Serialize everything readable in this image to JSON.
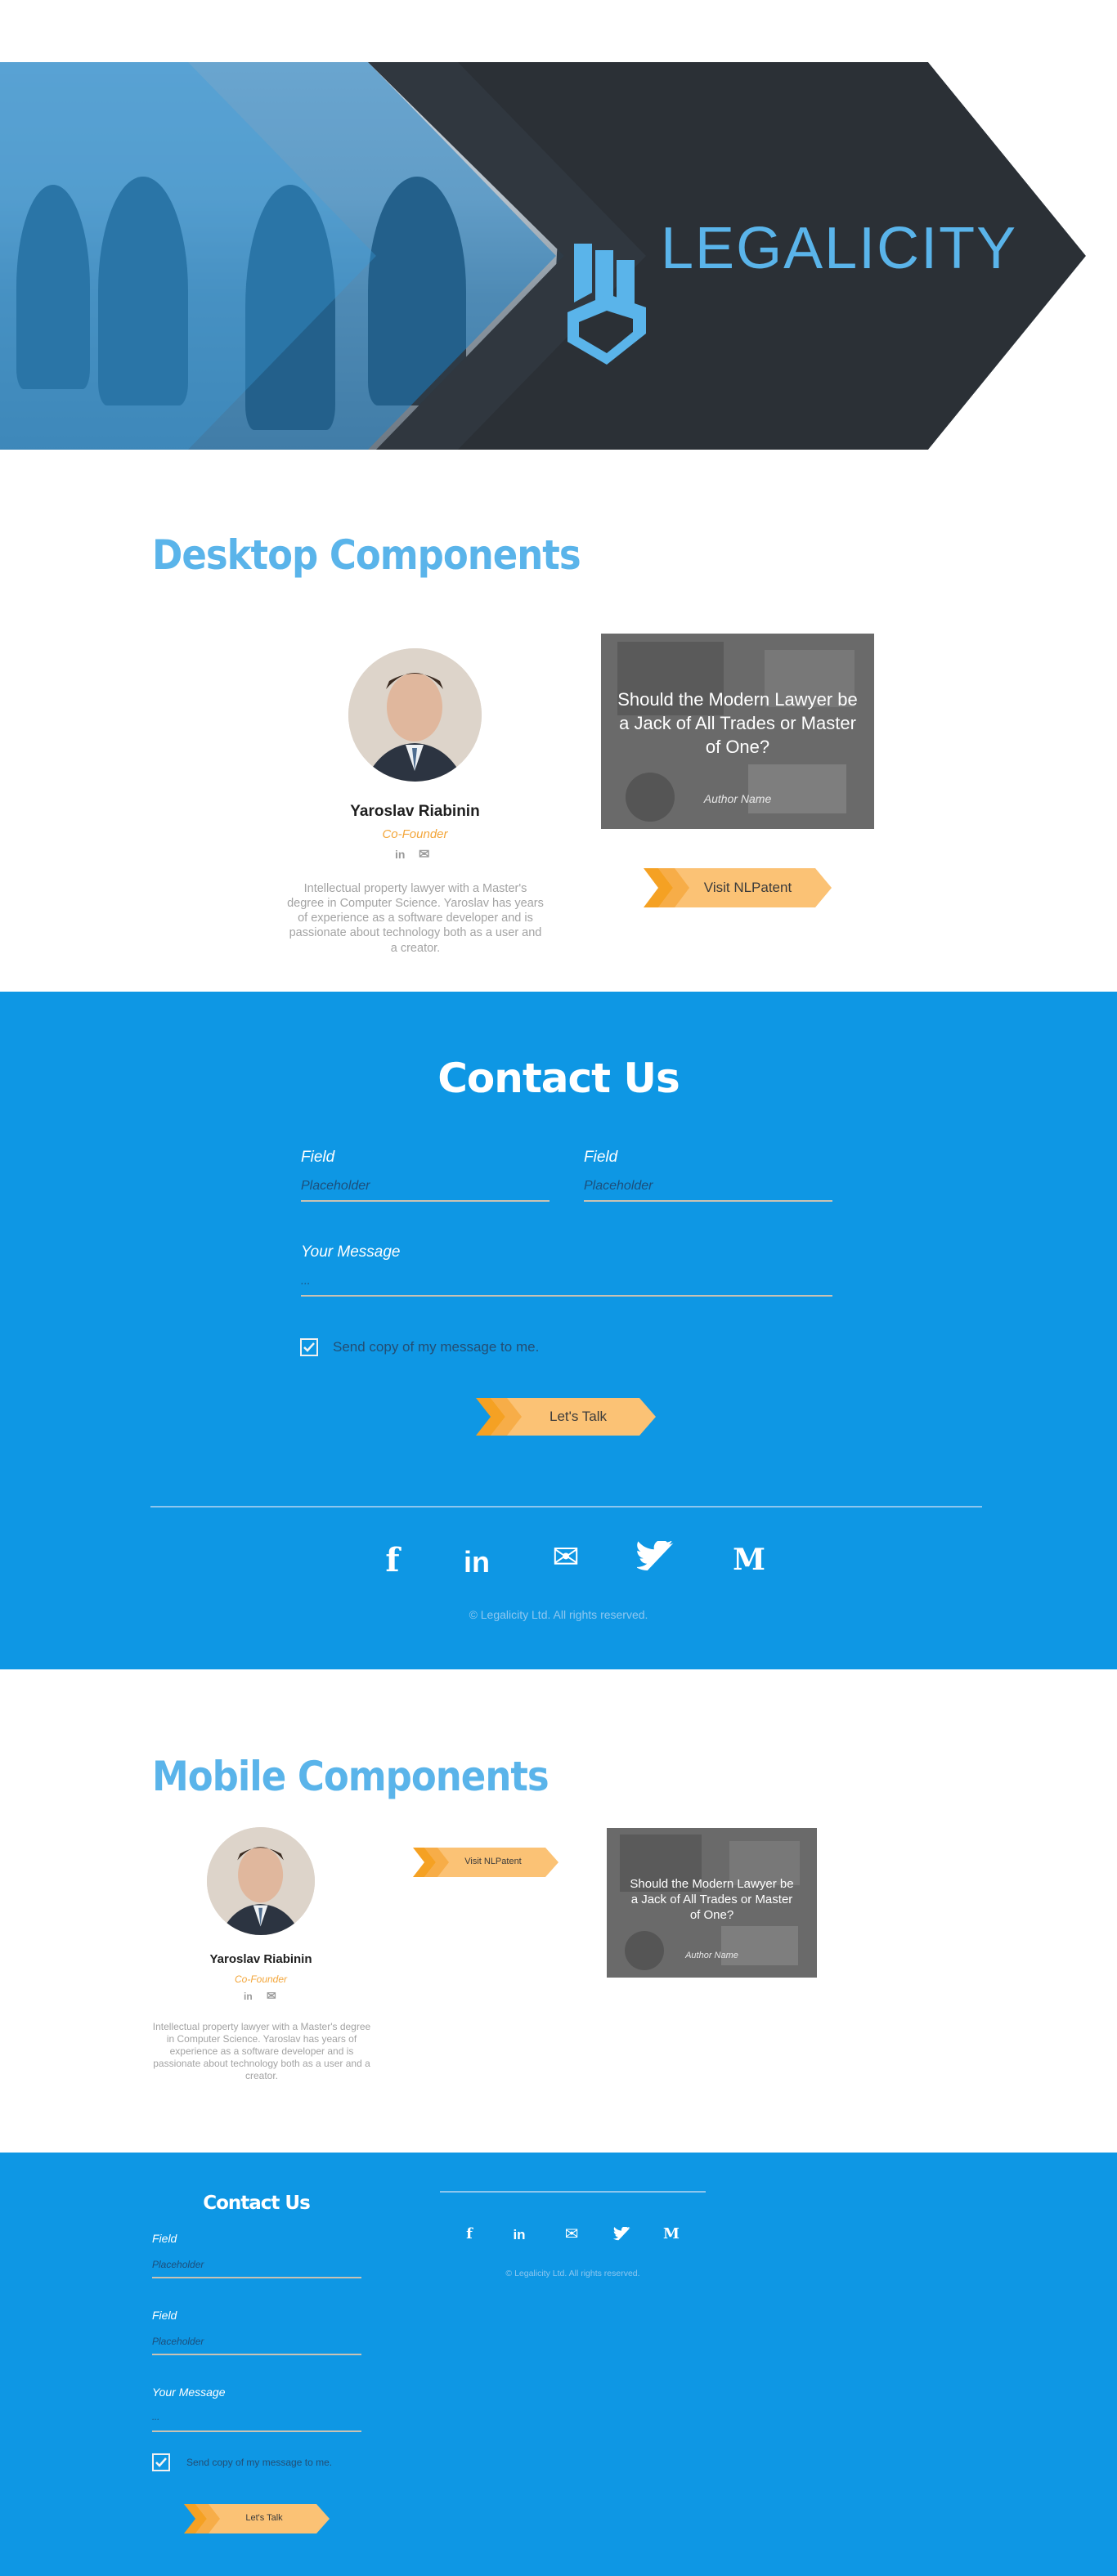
{
  "hero": {
    "logo_text": "LEGALICITY",
    "logo_icon": "legalicity-building-icon",
    "colors": {
      "accent": "#5ab4ea",
      "dark": "#2b3036"
    }
  },
  "desktop": {
    "section_title": "Desktop Components",
    "profile": {
      "name": "Yaroslav Riabinin",
      "role": "Co-Founder",
      "social": [
        "linkedin-icon",
        "email-icon"
      ],
      "linkedin_glyph": "in",
      "email_glyph": "✉",
      "bio": "Intellectual property lawyer with a Master's degree in Computer Science. Yaroslav has years of experience as a software developer and is passionate about technology both as a user and a creator."
    },
    "article": {
      "title": "Should the Modern Lawyer be a Jack of All Trades or Master of One?",
      "author": "Author Name"
    },
    "visit_button": "Visit NLPatent"
  },
  "contact_desktop": {
    "title": "Contact Us",
    "field1_label": "Field",
    "field1_placeholder": "Placeholder",
    "field2_label": "Field",
    "field2_placeholder": "Placeholder",
    "message_label": "Your Message",
    "message_placeholder": "...",
    "checkbox_label": "Send copy of my message to me.",
    "checkbox_checked": true,
    "submit": "Let's Talk",
    "social_glyphs": {
      "facebook": "f",
      "linkedin": "in",
      "email": "✉",
      "twitter": "🐦",
      "medium": "M"
    },
    "copyright": "© Legalicity Ltd. All rights reserved."
  },
  "mobile": {
    "section_title": "Mobile Components",
    "profile": {
      "name": "Yaroslav Riabinin",
      "role": "Co-Founder",
      "bio": "Intellectual property lawyer with a Master's degree in Computer Science. Yaroslav has years of experience as a software developer and is passionate about technology both as a user and a creator."
    },
    "visit_button": "Visit NLPatent",
    "article": {
      "title": "Should the Modern Lawyer be a Jack of All Trades or Master of One?",
      "author": "Author Name"
    }
  },
  "contact_mobile": {
    "title": "Contact Us",
    "field1_label": "Field",
    "field1_placeholder": "Placeholder",
    "field2_label": "Field",
    "field2_placeholder": "Placeholder",
    "message_label": "Your Message",
    "message_placeholder": "...",
    "checkbox_label": "Send copy of my message to me.",
    "checkbox_checked": true,
    "submit": "Let's Talk",
    "copyright": "© Legalicity Ltd. All rights reserved."
  }
}
